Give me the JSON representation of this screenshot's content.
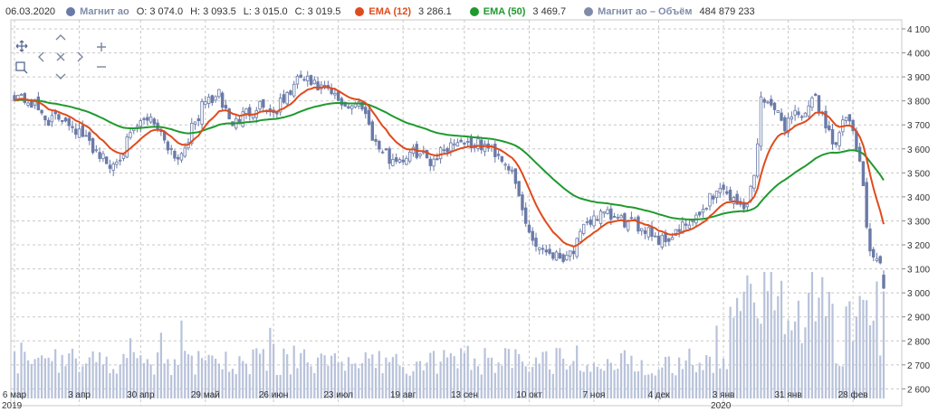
{
  "legend": {
    "date": "06.03.2020",
    "series_name": "Магнит ао",
    "open_label": "O:",
    "open": "3 074.0",
    "high_label": "H:",
    "high": "3 093.5",
    "low_label": "L:",
    "low": "3 015.0",
    "close_label": "C:",
    "close": "3 019.5",
    "ema12_label": "EMA (12)",
    "ema12": "3 286.1",
    "ema50_label": "EMA (50)",
    "ema50": "3 469.7",
    "volume_label": "Магнит ао – Объём",
    "volume": "484 879 233"
  },
  "colors": {
    "candle": "#6a7aa8",
    "ema12": "#e04b1c",
    "ema50": "#1f9a2e",
    "volume": "#b8c2da",
    "grid": "#c8c8c8"
  },
  "icons": [
    "move-icon",
    "zoom-rect-icon",
    "arrow-up-icon",
    "arrow-left-icon",
    "reset-icon",
    "arrow-right-icon",
    "arrow-down-icon",
    "zoom-in-icon",
    "zoom-out-icon"
  ],
  "chart_data": {
    "type": "candlestick",
    "y_axis": {
      "min": 2560,
      "max": 4130,
      "ticks": [
        4100,
        4000,
        3900,
        3800,
        3700,
        3600,
        3500,
        3400,
        3300,
        3200,
        3100,
        3000,
        2900,
        2800,
        2700,
        2600
      ]
    },
    "x_axis": {
      "ticks": [
        {
          "label": "6 мар",
          "sub": "2019",
          "t": 0
        },
        {
          "label": "3 апр",
          "sub": "",
          "t": 19
        },
        {
          "label": "30 апр",
          "sub": "",
          "t": 37
        },
        {
          "label": "29 май",
          "sub": "",
          "t": 56
        },
        {
          "label": "26 июн",
          "sub": "",
          "t": 76
        },
        {
          "label": "23 июл",
          "sub": "",
          "t": 95
        },
        {
          "label": "19 авг",
          "sub": "",
          "t": 114
        },
        {
          "label": "13 сен",
          "sub": "",
          "t": 132
        },
        {
          "label": "10 окт",
          "sub": "",
          "t": 151
        },
        {
          "label": "7 ноя",
          "sub": "",
          "t": 170
        },
        {
          "label": "4 дек",
          "sub": "",
          "t": 189
        },
        {
          "label": "3 янв",
          "sub": "2020",
          "t": 208
        },
        {
          "label": "31 янв",
          "sub": "",
          "t": 227
        },
        {
          "label": "28 фев",
          "sub": "",
          "t": 246
        }
      ],
      "count": 252
    },
    "close_anchors": [
      [
        0,
        3830
      ],
      [
        5,
        3790
      ],
      [
        10,
        3720
      ],
      [
        15,
        3730
      ],
      [
        20,
        3650
      ],
      [
        25,
        3580
      ],
      [
        28,
        3520
      ],
      [
        32,
        3600
      ],
      [
        36,
        3690
      ],
      [
        40,
        3740
      ],
      [
        45,
        3620
      ],
      [
        48,
        3560
      ],
      [
        52,
        3680
      ],
      [
        56,
        3800
      ],
      [
        60,
        3820
      ],
      [
        64,
        3700
      ],
      [
        68,
        3750
      ],
      [
        72,
        3790
      ],
      [
        76,
        3750
      ],
      [
        80,
        3820
      ],
      [
        84,
        3900
      ],
      [
        88,
        3860
      ],
      [
        92,
        3840
      ],
      [
        95,
        3800
      ],
      [
        98,
        3780
      ],
      [
        102,
        3790
      ],
      [
        106,
        3620
      ],
      [
        110,
        3560
      ],
      [
        114,
        3560
      ],
      [
        118,
        3590
      ],
      [
        122,
        3550
      ],
      [
        126,
        3600
      ],
      [
        130,
        3640
      ],
      [
        134,
        3620
      ],
      [
        138,
        3610
      ],
      [
        142,
        3580
      ],
      [
        145,
        3530
      ],
      [
        148,
        3400
      ],
      [
        150,
        3290
      ],
      [
        153,
        3200
      ],
      [
        156,
        3180
      ],
      [
        160,
        3150
      ],
      [
        164,
        3180
      ],
      [
        167,
        3260
      ],
      [
        170,
        3320
      ],
      [
        174,
        3320
      ],
      [
        178,
        3300
      ],
      [
        182,
        3280
      ],
      [
        186,
        3270
      ],
      [
        189,
        3220
      ],
      [
        192,
        3230
      ],
      [
        196,
        3270
      ],
      [
        200,
        3300
      ],
      [
        204,
        3400
      ],
      [
        208,
        3440
      ],
      [
        211,
        3380
      ],
      [
        214,
        3350
      ],
      [
        217,
        3480
      ],
      [
        219,
        3800
      ],
      [
        221,
        3820
      ],
      [
        223,
        3750
      ],
      [
        226,
        3700
      ],
      [
        229,
        3760
      ],
      [
        232,
        3730
      ],
      [
        235,
        3820
      ],
      [
        238,
        3700
      ],
      [
        241,
        3620
      ],
      [
        244,
        3740
      ],
      [
        246,
        3650
      ],
      [
        248,
        3550
      ],
      [
        250,
        3300
      ],
      [
        251,
        3200
      ],
      [
        252,
        3150
      ],
      [
        254,
        3130
      ],
      [
        255,
        3020
      ]
    ],
    "ema12_last": 3286.1,
    "ema50_last": 3469.7,
    "last_candle": {
      "date": "06.03.2020",
      "open": 3074.0,
      "high": 3093.5,
      "low": 3015.0,
      "close": 3019.5,
      "volume": 484879233
    }
  }
}
